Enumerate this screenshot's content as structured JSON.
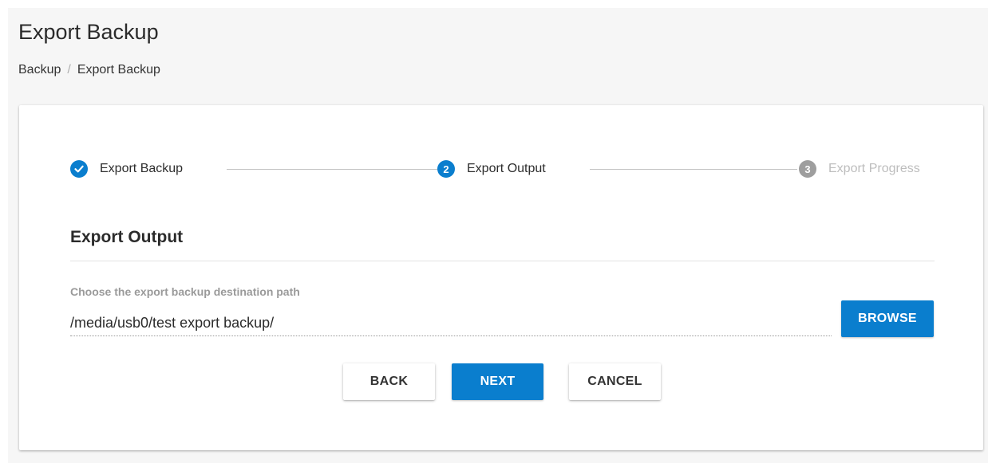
{
  "header": {
    "title": "Export Backup",
    "breadcrumb": [
      "Backup",
      "Export Backup"
    ],
    "breadcrumb_separator": "/"
  },
  "stepper": {
    "steps": [
      {
        "label": "Export Backup",
        "marker": "✓",
        "state": "completed"
      },
      {
        "label": "Export Output",
        "marker": "2",
        "state": "active"
      },
      {
        "label": "Export Progress",
        "marker": "3",
        "state": "pending"
      }
    ]
  },
  "section": {
    "title": "Export Output",
    "field_label": "Choose the export backup destination path",
    "path_value": "/media/usb0/test export backup/"
  },
  "buttons": {
    "browse": "BROWSE",
    "back": "BACK",
    "next": "NEXT",
    "cancel": "CANCEL"
  },
  "colors": {
    "accent": "#0a7ece",
    "pending": "#9e9e9e"
  }
}
